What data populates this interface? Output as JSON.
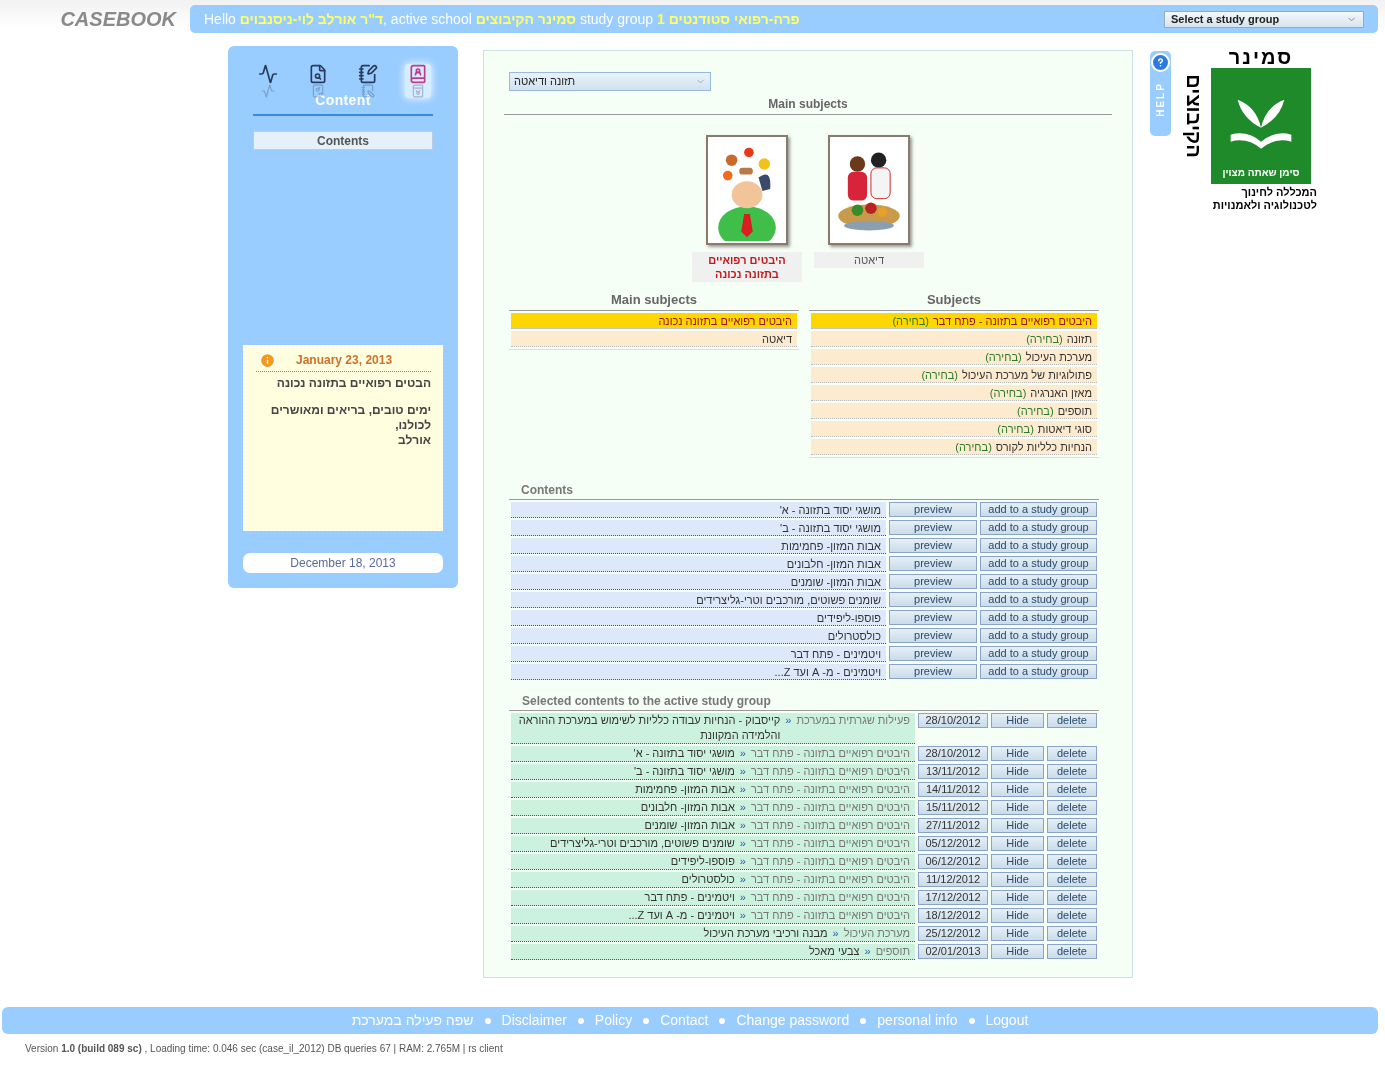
{
  "header": {
    "brand": "CASEBOOK",
    "greeting": "Hello **ד\"ר אורלב לוי-ניסנבוים**, active school **סמינר הקיבוצים** study group **1 פרה-רפואי סטודנטים**",
    "study_group_select": "Select a study group"
  },
  "sidebar": {
    "nav_icons": [
      {
        "selected": false
      },
      {
        "selected": false
      },
      {
        "selected": false
      },
      {
        "selected": true
      }
    ],
    "section_title": "Content",
    "items": [
      {
        "label": "Contents",
        "selected": true
      }
    ],
    "note": {
      "date": "January 23, 2013",
      "paragraphs": [
        "הבטים רפואיים בתזונה נכונה",
        "ימים טובים, בריאים ומאושרים\nלכולנו,\nאורלב"
      ]
    },
    "footer_date": "December 18, 2013"
  },
  "main": {
    "category_select": "תזונה ודיאטה",
    "cards_title": "Main subjects",
    "cards": [
      {
        "label": "דיאטה",
        "selected": false
      },
      {
        "label": "היבטים רפואיים בתזונה נכונה",
        "selected": true
      }
    ],
    "main_subjects": {
      "title": "Main subjects",
      "items": [
        {
          "label": "היבטים רפואיים בתזונה נכונה",
          "selected": true
        },
        {
          "label": "דיאטה",
          "selected": false
        }
      ]
    },
    "subjects": {
      "title": "Subjects",
      "items": [
        {
          "label": "היבטים רפואיים בתזונה - פתח דבר",
          "tag": "(בחירה)",
          "selected": true
        },
        {
          "label": "תזונה",
          "tag": "(בחירה)",
          "selected": false
        },
        {
          "label": "מערכת העיכול",
          "tag": "(בחירה)",
          "selected": false
        },
        {
          "label": "פתולוגיות של מערכת העיכול",
          "tag": "(בחירה)",
          "selected": false
        },
        {
          "label": "מאזן האנרגיה",
          "tag": "(בחירה)",
          "selected": false
        },
        {
          "label": "תוספים",
          "tag": "(בחירה)",
          "selected": false
        },
        {
          "label": "סוגי דיאטות",
          "tag": "(בחירה)",
          "selected": false
        },
        {
          "label": "הנחיות כלליות לקורס",
          "tag": "(בחירה)",
          "selected": false
        }
      ]
    },
    "contents": {
      "title": "Contents",
      "rows": [
        {
          "title": "מושגי יסוד בתזונה - א'",
          "preview": "preview",
          "add": "add to a study group"
        },
        {
          "title": "מושגי יסוד בתזונה - ב'",
          "preview": "preview",
          "add": "add to a study group"
        },
        {
          "title": "אבות המזון- פחמימות",
          "preview": "preview",
          "add": "add to a study group"
        },
        {
          "title": "אבות המזון- חלבונים",
          "preview": "preview",
          "add": "add to a study group"
        },
        {
          "title": "אבות המזון- שומנים",
          "preview": "preview",
          "add": "add to a study group"
        },
        {
          "title": "שומנים פשוטים, מורכבים וטרי-גליצרידים",
          "preview": "preview",
          "add": "add to a study group"
        },
        {
          "title": "פוספו-ליפידים",
          "preview": "preview",
          "add": "add to a study group"
        },
        {
          "title": "כולסטרולים",
          "preview": "preview",
          "add": "add to a study group"
        },
        {
          "title": "ויטמינים - פתח דבר",
          "preview": "preview",
          "add": "add to a study group"
        },
        {
          "title": "ויטמינים - מ- A ועד Z...",
          "preview": "preview",
          "add": "add to a study group"
        }
      ]
    },
    "selected_contents": {
      "title": "Selected contents to the active study group",
      "rows": [
        {
          "category": "פעילות שגרתית במערכת",
          "separator": "«",
          "title": "קייסבוק - הנחיות עבודה כלליות לשימוש במערכת ההוראה והלמידה המקוונת",
          "date": "28/10/2012",
          "hide": "Hide",
          "delete": "delete"
        },
        {
          "category": "היבטים רפואיים בתזונה - פתח דבר",
          "separator": "«",
          "title": "מושגי יסוד בתזונה - א'",
          "date": "28/10/2012",
          "hide": "Hide",
          "delete": "delete"
        },
        {
          "category": "היבטים רפואיים בתזונה - פתח דבר",
          "separator": "«",
          "title": "מושגי יסוד בתזונה - ב'",
          "date": "13/11/2012",
          "hide": "Hide",
          "delete": "delete"
        },
        {
          "category": "היבטים רפואיים בתזונה - פתח דבר",
          "separator": "«",
          "title": "אבות המזון- פחמימות",
          "date": "14/11/2012",
          "hide": "Hide",
          "delete": "delete"
        },
        {
          "category": "היבטים רפואיים בתזונה - פתח דבר",
          "separator": "«",
          "title": "אבות המזון- חלבונים",
          "date": "15/11/2012",
          "hide": "Hide",
          "delete": "delete"
        },
        {
          "category": "היבטים רפואיים בתזונה - פתח דבר",
          "separator": "«",
          "title": "אבות המזון- שומנים",
          "date": "27/11/2012",
          "hide": "Hide",
          "delete": "delete"
        },
        {
          "category": "היבטים רפואיים בתזונה - פתח דבר",
          "separator": "«",
          "title": "שומנים פשוטים, מורכבים וטרי-גליצרידים",
          "date": "05/12/2012",
          "hide": "Hide",
          "delete": "delete"
        },
        {
          "category": "היבטים רפואיים בתזונה - פתח דבר",
          "separator": "«",
          "title": "פוספו-ליפידים",
          "date": "06/12/2012",
          "hide": "Hide",
          "delete": "delete"
        },
        {
          "category": "היבטים רפואיים בתזונה - פתח דבר",
          "separator": "«",
          "title": "כולסטרולים",
          "date": "11/12/2012",
          "hide": "Hide",
          "delete": "delete"
        },
        {
          "category": "היבטים רפואיים בתזונה - פתח דבר",
          "separator": "«",
          "title": "ויטמינים - פתח דבר",
          "date": "17/12/2012",
          "hide": "Hide",
          "delete": "delete"
        },
        {
          "category": "היבטים רפואיים בתזונה - פתח דבר",
          "separator": "«",
          "title": "ויטמינים - מ- A ועד Z...",
          "date": "18/12/2012",
          "hide": "Hide",
          "delete": "delete"
        },
        {
          "category": "מערכת העיכול",
          "separator": "«",
          "title": "מבנה ורכיבי מערכת העיכול",
          "date": "25/12/2012",
          "hide": "Hide",
          "delete": "delete"
        },
        {
          "category": "תוספים",
          "separator": "«",
          "title": "צבעי מאכל",
          "date": "02/01/2013",
          "hide": "Hide",
          "delete": "delete"
        }
      ]
    }
  },
  "help_tab": "HELP",
  "logo": {
    "top": "סמינר",
    "side": "הקיבוצים",
    "slogan": "סימן שאתה מצוין",
    "line1": "המכללה לחינוך",
    "line2": "לטכנולוגיה ולאמנויות"
  },
  "footer": {
    "links": [
      "Logout",
      "personal info",
      "Change password",
      "Contact",
      "Policy",
      "Disclaimer",
      "שפה פעילה במערכת"
    ],
    "version": "Version **1.0 (build 089 sc)** , Loading time: 0.046 sec  (case_il_2012) DB queries 67 | RAM: 2.765M | rs client"
  }
}
